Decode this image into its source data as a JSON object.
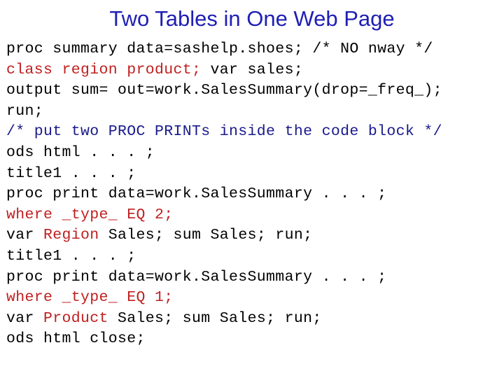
{
  "slide": {
    "title": "Two Tables in One Web Page",
    "title_color": "#1f1fb4",
    "background_color": "#ffffff"
  },
  "colors": {
    "code_default": "#000000",
    "code_red": "#c02020",
    "code_blue": "#1a1a8c"
  },
  "code": {
    "language": "SAS",
    "lines": [
      {
        "index": 1,
        "text": "proc summary data=sashelp.shoes; /* NO nway */",
        "tokens": [
          {
            "text": "proc summary data=sashelp.shoes; /* NO nway */",
            "color": "black"
          }
        ]
      },
      {
        "index": 2,
        "text": "class region product; var sales;",
        "tokens": [
          {
            "text": "class region product;",
            "color": "red"
          },
          {
            "text": " var sales;",
            "color": "black"
          }
        ]
      },
      {
        "index": 3,
        "text": "output sum= out=work.SalesSummary(drop=_freq_);",
        "tokens": [
          {
            "text": "output sum= out=work.SalesSummary(drop=_freq_);",
            "color": "black"
          }
        ]
      },
      {
        "index": 4,
        "text": "run;",
        "tokens": [
          {
            "text": "run;",
            "color": "black"
          }
        ]
      },
      {
        "index": 5,
        "text": "/* put two PROC PRINTs inside the code block */",
        "tokens": [
          {
            "text": "/* put two PROC PRINTs inside the code block */",
            "color": "blue"
          }
        ]
      },
      {
        "index": 6,
        "text": "ods html . . . ;",
        "tokens": [
          {
            "text": "ods html . . . ;",
            "color": "black"
          }
        ]
      },
      {
        "index": 7,
        "text": "title1 . . . ;",
        "tokens": [
          {
            "text": "title1 . . . ;",
            "color": "black"
          }
        ]
      },
      {
        "index": 8,
        "text": "proc print data=work.SalesSummary . . . ;",
        "tokens": [
          {
            "text": "proc print data=work.SalesSummary . . . ;",
            "color": "black"
          }
        ]
      },
      {
        "index": 9,
        "text": "where _type_ EQ 2;",
        "tokens": [
          {
            "text": "where _type_ EQ 2;",
            "color": "red"
          }
        ]
      },
      {
        "index": 10,
        "text": "var Region Sales; sum Sales; run;",
        "tokens": [
          {
            "text": "var ",
            "color": "black"
          },
          {
            "text": "Region",
            "color": "red"
          },
          {
            "text": " Sales; sum Sales; run;",
            "color": "black"
          }
        ]
      },
      {
        "index": 11,
        "text": "title1 . . . ;",
        "tokens": [
          {
            "text": "title1 . . . ;",
            "color": "black"
          }
        ]
      },
      {
        "index": 12,
        "text": "proc print data=work.SalesSummary . . . ;",
        "tokens": [
          {
            "text": "proc print data=work.SalesSummary . . . ;",
            "color": "black"
          }
        ]
      },
      {
        "index": 13,
        "text": "where _type_ EQ 1;",
        "tokens": [
          {
            "text": "where _type_ EQ 1;",
            "color": "red"
          }
        ]
      },
      {
        "index": 14,
        "text": "var Product Sales; sum Sales; run;",
        "tokens": [
          {
            "text": "var ",
            "color": "black"
          },
          {
            "text": "Product",
            "color": "red"
          },
          {
            "text": " Sales; sum Sales; run;",
            "color": "black"
          }
        ]
      },
      {
        "index": 15,
        "text": "ods html close;",
        "tokens": [
          {
            "text": "ods html close;",
            "color": "black"
          }
        ]
      }
    ]
  }
}
